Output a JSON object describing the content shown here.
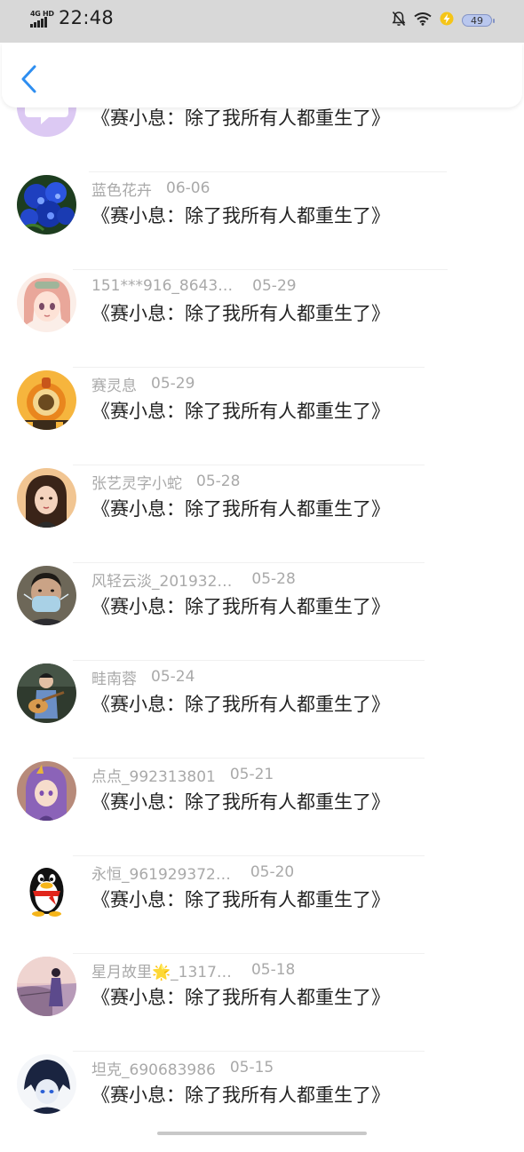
{
  "status_bar": {
    "network": "4G HD",
    "time": "22:48",
    "battery": "49"
  },
  "header": {
    "back_icon": "chevron-left-icon"
  },
  "items": [
    {
      "name": "",
      "date": "",
      "message": "《赛小息：除了我所有人都重生了》",
      "avatar": "purple-chat-avatar"
    },
    {
      "name": "蓝色花卉",
      "date": "06-06",
      "message": "《赛小息：除了我所有人都重生了》",
      "avatar": "blue-flowers-avatar"
    },
    {
      "name": "151***916_8643…",
      "date": "05-29",
      "message": "《赛小息：除了我所有人都重生了》",
      "avatar": "anime-girl-avatar"
    },
    {
      "name": "赛灵息",
      "date": "05-29",
      "message": "《赛小息：除了我所有人都重生了》",
      "avatar": "orange-character-avatar"
    },
    {
      "name": "张艺灵字小蛇",
      "date": "05-28",
      "message": "《赛小息：除了我所有人都重生了》",
      "avatar": "girl-portrait-avatar"
    },
    {
      "name": "风轻云淡_201932…",
      "date": "05-28",
      "message": "《赛小息：除了我所有人都重生了》",
      "avatar": "masked-man-avatar"
    },
    {
      "name": "畦南蓉",
      "date": "05-24",
      "message": "《赛小息：除了我所有人都重生了》",
      "avatar": "guitar-player-avatar"
    },
    {
      "name": "点点_992313801",
      "date": "05-21",
      "message": "《赛小息：除了我所有人都重生了》",
      "avatar": "purple-hair-girl-avatar"
    },
    {
      "name": "永恒_961929372…",
      "date": "05-20",
      "message": "《赛小息：除了我所有人都重生了》",
      "avatar": "qq-penguin-avatar"
    },
    {
      "name": "星月故里🌟_1317…",
      "date": "05-18",
      "message": "《赛小息：除了我所有人都重生了》",
      "avatar": "sunset-girl-avatar"
    },
    {
      "name": "坦克_690683986",
      "date": "05-15",
      "message": "《赛小息：除了我所有人都重生了》",
      "avatar": "dark-anime-boy-avatar"
    }
  ]
}
